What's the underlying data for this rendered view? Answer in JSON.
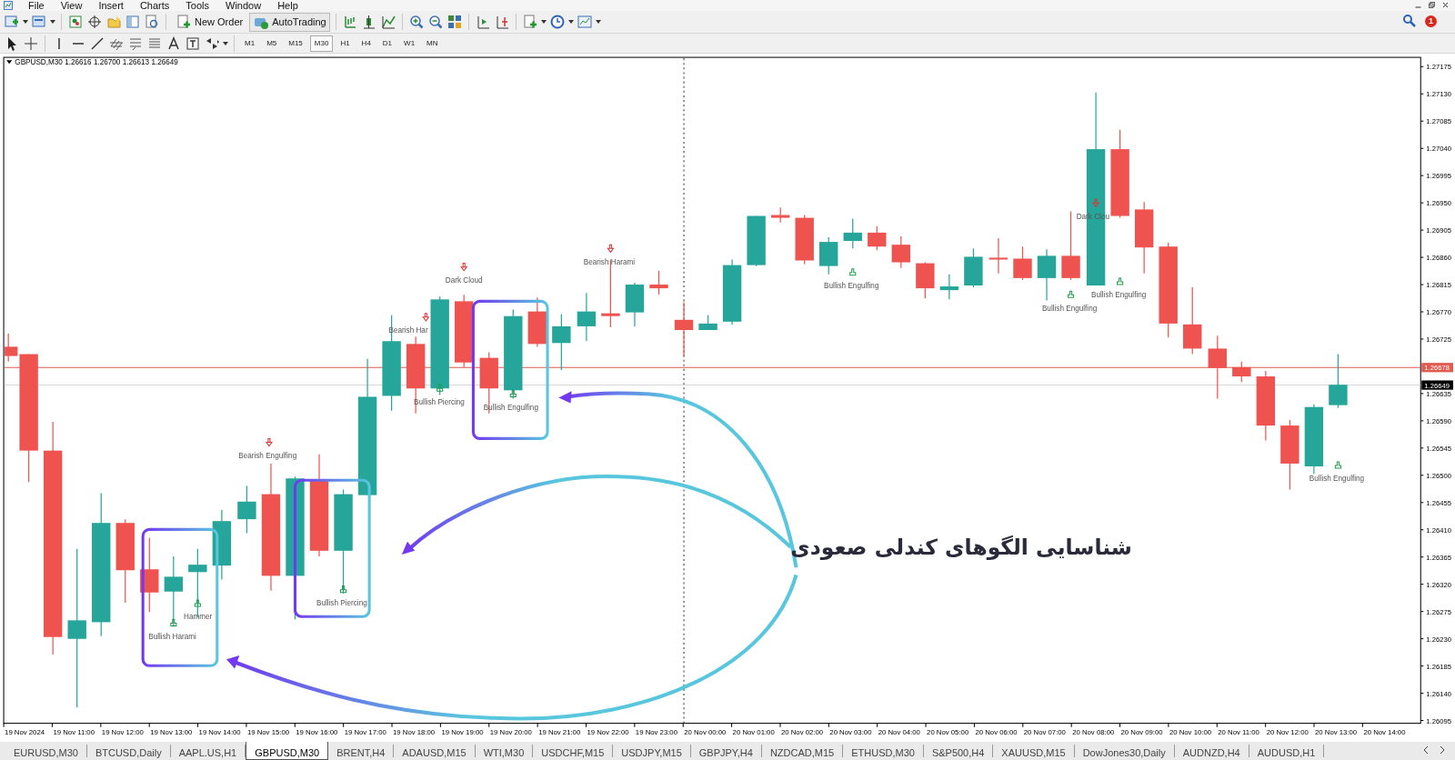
{
  "menu": [
    "File",
    "View",
    "Insert",
    "Charts",
    "Tools",
    "Window",
    "Help"
  ],
  "toolbar": {
    "buttons": [
      {
        "label": "New Order",
        "kind": "order"
      },
      {
        "label": "AutoTrading",
        "kind": "auto"
      }
    ],
    "timeframes": [
      {
        "label": "M1",
        "selected": false
      },
      {
        "label": "M5",
        "selected": false
      },
      {
        "label": "M15",
        "selected": false
      },
      {
        "label": "M30",
        "selected": true
      },
      {
        "label": "H1",
        "selected": false
      },
      {
        "label": "H4",
        "selected": false
      },
      {
        "label": "D1",
        "selected": false
      },
      {
        "label": "W1",
        "selected": false
      },
      {
        "label": "MN",
        "selected": false
      }
    ]
  },
  "notifications": "1",
  "chart": {
    "title": "GBPUSD,M30  1.26616 1.26700 1.26613 1.26649",
    "price_axis": [
      "1.27175",
      "1.27130",
      "1.27085",
      "1.27040",
      "1.26995",
      "1.26950",
      "1.26905",
      "1.26860",
      "1.26815",
      "1.26770",
      "1.26725",
      "1.26635",
      "1.26590",
      "1.26545",
      "1.26500",
      "1.26455",
      "1.26410",
      "1.26365",
      "1.26320",
      "1.26275",
      "1.26230",
      "1.26185",
      "1.26140",
      "1.26095"
    ],
    "price_lines": [
      {
        "price": "1.26678",
        "kind": "bid"
      },
      {
        "price": "1.26649",
        "kind": "last"
      }
    ],
    "time_axis": [
      "19 Nov 2024",
      "19 Nov 11:00",
      "19 Nov 12:00",
      "19 Nov 13:00",
      "19 Nov 14:00",
      "19 Nov 15:00",
      "19 Nov 16:00",
      "19 Nov 17:00",
      "19 Nov 18:00",
      "19 Nov 19:00",
      "19 Nov 20:00",
      "19 Nov 21:00",
      "19 Nov 22:00",
      "19 Nov 23:00",
      "20 Nov 00:00",
      "20 Nov 01:00",
      "20 Nov 02:00",
      "20 Nov 03:00",
      "20 Nov 04:00",
      "20 Nov 05:00",
      "20 Nov 06:00",
      "20 Nov 07:00",
      "20 Nov 08:00",
      "20 Nov 09:00",
      "20 Nov 10:00",
      "20 Nov 11:00",
      "20 Nov 12:00",
      "20 Nov 13:00",
      "20 Nov 14:00"
    ],
    "patterns": [
      {
        "label": "Bullish Harami",
        "kind": "bullish"
      },
      {
        "label": "Hammer",
        "kind": "bullish"
      },
      {
        "label": "Bearish Engulfing",
        "kind": "bearish"
      },
      {
        "label": "Bullish Piercing",
        "kind": "bullish"
      },
      {
        "label": "Bearish Har",
        "kind": "bearish"
      },
      {
        "label": "Dark Cloud",
        "kind": "bearish"
      },
      {
        "label": "Bullish Piercing",
        "kind": "bullish"
      },
      {
        "label": "Bullish Engulfing",
        "kind": "bullish"
      },
      {
        "label": "Bearish Harami",
        "kind": "bearish"
      },
      {
        "label": "Bullish Engulfing",
        "kind": "bullish"
      },
      {
        "label": "Dark Clou",
        "kind": "bearish"
      },
      {
        "label": "Bullish Engulfing",
        "kind": "bullish"
      },
      {
        "label": "Bullish Engulfing",
        "kind": "bullish"
      },
      {
        "label": "Bullish Engulfing",
        "kind": "bullish"
      }
    ],
    "annotation": "شناسایی الگوهای کندلی صعودی"
  },
  "tabs": [
    {
      "label": "EURUSD,M30",
      "selected": false
    },
    {
      "label": "BTCUSD,Daily",
      "selected": false
    },
    {
      "label": "AAPL.US,H1",
      "selected": false
    },
    {
      "label": "GBPUSD,M30",
      "selected": true
    },
    {
      "label": "BRENT,H4",
      "selected": false
    },
    {
      "label": "ADAUSD,M15",
      "selected": false
    },
    {
      "label": "WTI,M30",
      "selected": false
    },
    {
      "label": "USDCHF,M15",
      "selected": false
    },
    {
      "label": "USDJPY,M15",
      "selected": false
    },
    {
      "label": "GBPJPY,H4",
      "selected": false
    },
    {
      "label": "NZDCAD,M15",
      "selected": false
    },
    {
      "label": "ETHUSD,M30",
      "selected": false
    },
    {
      "label": "S&P500,H4",
      "selected": false
    },
    {
      "label": "XAUUSD,M15",
      "selected": false
    },
    {
      "label": "DowJones30,Daily",
      "selected": false
    },
    {
      "label": "AUDNZD,H4",
      "selected": false
    },
    {
      "label": "AUDUSD,H1",
      "selected": false
    }
  ]
}
